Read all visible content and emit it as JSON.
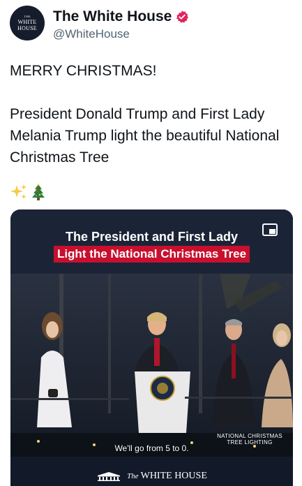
{
  "header": {
    "avatar_lines": [
      "THE",
      "WHITE HOUSE"
    ],
    "display_name": "The White House",
    "handle": "@WhiteHouse",
    "verified_color": "#e0245e"
  },
  "tweet": {
    "text": "MERRY CHRISTMAS!\n\nPresident Donald Trump and First Lady Melania Trump light the beautiful National Christmas Tree",
    "emojis": [
      "sparkles-icon",
      "christmas-tree-icon"
    ]
  },
  "media": {
    "title": "The President and First Lady",
    "subtitle": "Light the National Christmas Tree",
    "caption": "We'll go from 5 to 0.",
    "event_logo_lines": [
      "NATIONAL CHRISTMAS",
      "TREE LIGHTING"
    ],
    "footer_logo_prefix": "The",
    "footer_logo_text": "WHITE HOUSE",
    "accent": "#c8102e",
    "background": "#1a2335"
  }
}
